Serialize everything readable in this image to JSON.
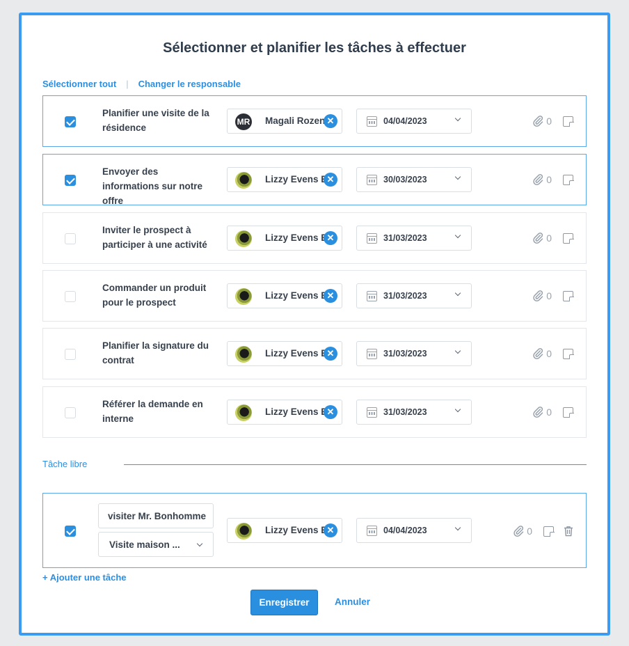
{
  "dialog": {
    "title": "Sélectionner et planifier les tâches à effectuer",
    "select_all": "Sélectionner tout",
    "change_owner": "Changer le responsable"
  },
  "tasks": [
    {
      "checked": true,
      "name": "Planifier une visite de la résidence",
      "assignee": "Magali Rozenberg",
      "avatar_initials": "MR",
      "date": "04/04/2023",
      "attachments": "0"
    },
    {
      "checked": true,
      "name": "Envoyer des informations sur notre offre",
      "assignee": "Lizzy Evens Be",
      "avatar_initials": "",
      "date": "30/03/2023",
      "attachments": "0"
    },
    {
      "checked": false,
      "name": "Inviter le prospect à participer à une activité",
      "assignee": "Lizzy Evens Be",
      "avatar_initials": "",
      "date": "31/03/2023",
      "attachments": "0"
    },
    {
      "checked": false,
      "name": "Commander un produit pour le prospect",
      "assignee": "Lizzy Evens Be",
      "avatar_initials": "",
      "date": "31/03/2023",
      "attachments": "0"
    },
    {
      "checked": false,
      "name": "Planifier la signature du contrat",
      "assignee": "Lizzy Evens Be",
      "avatar_initials": "",
      "date": "31/03/2023",
      "attachments": "0"
    },
    {
      "checked": false,
      "name": "Référer la demande en interne",
      "assignee": "Lizzy Evens Be",
      "avatar_initials": "",
      "date": "31/03/2023",
      "attachments": "0"
    }
  ],
  "free_task": {
    "section_label": "Tâche libre",
    "checked": true,
    "name_value": "visiter Mr. Bonhomme",
    "type_value": "Visite maison ...",
    "assignee": "Lizzy Evens Be",
    "date": "04/04/2023",
    "attachments": "0"
  },
  "footer": {
    "add_task": "+ Ajouter une tâche",
    "save": "Enregistrer",
    "cancel": "Annuler"
  },
  "icons": {
    "remove": "✕",
    "attachment": "paperclip-icon",
    "note": "note-icon",
    "calendar": "calendar-icon",
    "delete": "trash-icon"
  },
  "colors": {
    "accent": "#2b8fe0",
    "modal_border": "#3b9bf0"
  }
}
